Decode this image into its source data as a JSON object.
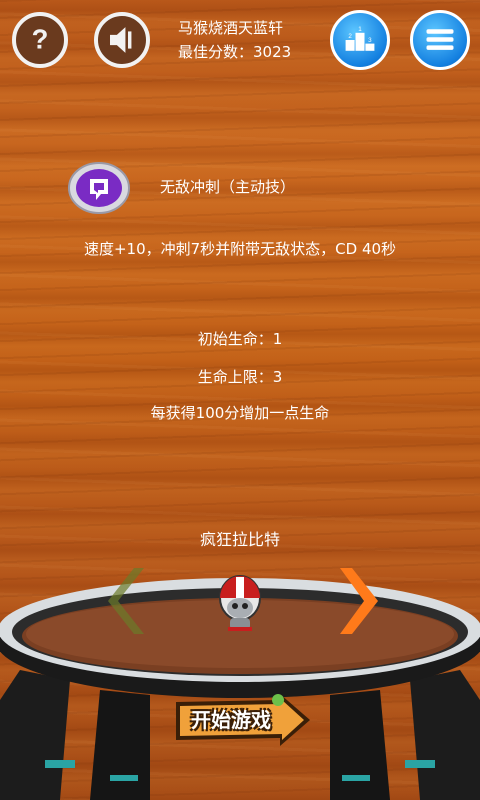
{
  "player": {
    "name": "马猴烧酒天蓝轩",
    "best_score": "最佳分数：3023"
  },
  "skill": {
    "title": "无敌冲刺（主动技）",
    "description": "速度+10，冲刺7秒并附带无敌状态，CD 40秒"
  },
  "stats": {
    "initial_life": "初始生命：1",
    "life_limit": "生命上限：3",
    "bonus_rule": "每获得100分增加一点生命"
  },
  "character": {
    "name": "疯狂拉比特"
  },
  "buttons": {
    "start": "开始游戏"
  },
  "icons": {
    "help": "help-icon",
    "sound": "sound-icon",
    "leaderboard": "leaderboard-icon",
    "menu": "menu-icon",
    "skill": "dash-skill-icon",
    "prev": "chevron-left-icon",
    "next": "chevron-right-icon"
  },
  "colors": {
    "wood": "#c3621b",
    "blue_button": "#1480e0",
    "next_arrow": "#ff7a1a",
    "prev_arrow": "#6b7a2a",
    "skill_purple": "#7a2bc4"
  }
}
